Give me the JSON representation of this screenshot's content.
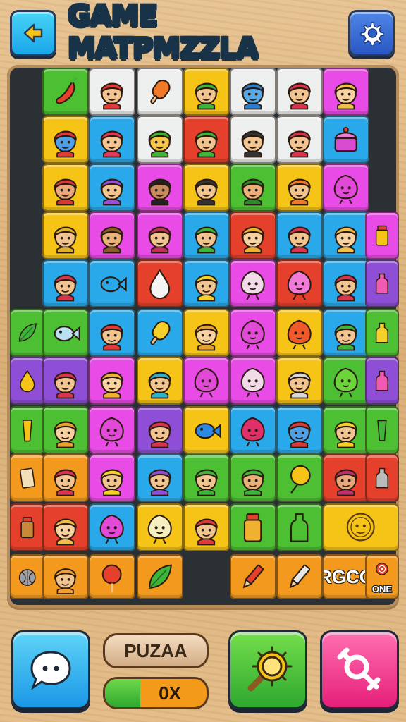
{
  "header": {
    "title": "GAME MATPMZZLA",
    "back_icon": "arrow-left-icon",
    "settings_icon": "gear-icon"
  },
  "colors": {
    "green": "#4cbf32",
    "white": "#eef0f0",
    "yellow": "#f6c417",
    "blue": "#2aa9ea",
    "pink": "#e94be6",
    "red": "#e5402b",
    "orange": "#f39a1e",
    "purple": "#8e4fd6",
    "board": "#2b3035",
    "wood": "#e2bb86"
  },
  "tiles": [
    {
      "row": 0,
      "col": 1,
      "color": "green",
      "icon": "chili-icon"
    },
    {
      "row": 0,
      "col": 2,
      "color": "white",
      "icon": "face-icon",
      "skin": "#f2c48f",
      "hair": "#e03a3a"
    },
    {
      "row": 0,
      "col": 3,
      "color": "white",
      "icon": "popsicle-icon"
    },
    {
      "row": 0,
      "col": 4,
      "color": "yellow",
      "icon": "face-icon",
      "skin": "#f2c48f",
      "hair": "#3fb43a"
    },
    {
      "row": 0,
      "col": 5,
      "color": "white",
      "icon": "face-icon",
      "skin": "#57a8e6",
      "hair": "#2a7fd0"
    },
    {
      "row": 0,
      "col": 6,
      "color": "white",
      "icon": "face-icon",
      "skin": "#f2c48f",
      "hair": "#d8344f"
    },
    {
      "row": 0,
      "col": 7,
      "color": "pink",
      "icon": "face-icon",
      "skin": "#f7d2a0",
      "hair": "#f0c04a"
    },
    {
      "row": 1,
      "col": 1,
      "color": "yellow",
      "icon": "face-icon",
      "skin": "#4ea0e8",
      "hair": "#e23a3a"
    },
    {
      "row": 1,
      "col": 2,
      "color": "blue",
      "icon": "face-icon",
      "skin": "#f2c48f",
      "hair": "#e03a5a"
    },
    {
      "row": 1,
      "col": 3,
      "color": "white",
      "icon": "face-icon",
      "skin": "#f6c84a",
      "hair": "#3fb43a"
    },
    {
      "row": 1,
      "col": 4,
      "color": "red",
      "icon": "face-icon",
      "skin": "#f2c48f",
      "hair": "#3fb43a"
    },
    {
      "row": 1,
      "col": 5,
      "color": "white",
      "icon": "face-icon",
      "skin": "#f2c48f",
      "hair": "#333333"
    },
    {
      "row": 1,
      "col": 6,
      "color": "white",
      "icon": "face-icon",
      "skin": "#f2c48f",
      "hair": "#d8344f"
    },
    {
      "row": 1,
      "col": 7,
      "color": "blue",
      "icon": "cake-icon"
    },
    {
      "row": 2,
      "col": 1,
      "color": "yellow",
      "icon": "face-icon",
      "skin": "#e9a87a",
      "hair": "#d83a3a"
    },
    {
      "row": 2,
      "col": 2,
      "color": "blue",
      "icon": "face-icon",
      "skin": "#f2c48f",
      "hair": "#9a4fd6"
    },
    {
      "row": 2,
      "col": 3,
      "color": "pink",
      "icon": "face-icon",
      "skin": "#c98a5e",
      "hair": "#222222"
    },
    {
      "row": 2,
      "col": 4,
      "color": "yellow",
      "icon": "face-icon",
      "skin": "#f2c48f",
      "hair": "#333333"
    },
    {
      "row": 2,
      "col": 5,
      "color": "green",
      "icon": "face-icon",
      "skin": "#e9b07a",
      "hair": "#2f8a2f"
    },
    {
      "row": 2,
      "col": 6,
      "color": "yellow",
      "icon": "face-icon",
      "skin": "#f2c48f",
      "hair": "#f07a2a"
    },
    {
      "row": 2,
      "col": 7,
      "color": "pink",
      "icon": "blob-icon",
      "fill": "#e04ad6"
    },
    {
      "row": 3,
      "col": 1,
      "color": "yellow",
      "icon": "face-icon",
      "skin": "#f2c48f",
      "hair": "#e0b02a"
    },
    {
      "row": 3,
      "col": 2,
      "color": "pink",
      "icon": "face-icon",
      "skin": "#e9b07a",
      "hair": "#8a5a2a"
    },
    {
      "row": 3,
      "col": 3,
      "color": "pink",
      "icon": "face-icon",
      "skin": "#f2c48f",
      "hair": "#c0305a"
    },
    {
      "row": 3,
      "col": 4,
      "color": "blue",
      "icon": "face-icon",
      "skin": "#f2c48f",
      "hair": "#3fb43a"
    },
    {
      "row": 3,
      "col": 5,
      "color": "red",
      "icon": "face-icon",
      "skin": "#f7d2a0",
      "hair": "#f0b030"
    },
    {
      "row": 3,
      "col": 6,
      "color": "blue",
      "icon": "face-icon",
      "skin": "#f2c48f",
      "hair": "#d8344f"
    },
    {
      "row": 3,
      "col": 7,
      "color": "blue",
      "icon": "face-icon",
      "skin": "#f7d2a0",
      "hair": "#f0c04a"
    },
    {
      "row": 3,
      "col": 8,
      "color": "pink",
      "icon": "jar-icon",
      "fill": "#f6c417",
      "narrow": true
    },
    {
      "row": 4,
      "col": 1,
      "color": "blue",
      "icon": "face-icon",
      "skin": "#f2c48f",
      "hair": "#d8344f"
    },
    {
      "row": 4,
      "col": 2,
      "color": "blue",
      "icon": "fish-icon",
      "fill": "#2aa9ea"
    },
    {
      "row": 4,
      "col": 3,
      "color": "red",
      "icon": "drop-icon",
      "fill": "#f4f4f4"
    },
    {
      "row": 4,
      "col": 4,
      "color": "blue",
      "icon": "face-icon",
      "skin": "#f2c48f",
      "hair": "#f6d02a"
    },
    {
      "row": 4,
      "col": 5,
      "color": "pink",
      "icon": "blob-icon",
      "fill": "#f2dbe8"
    },
    {
      "row": 4,
      "col": 6,
      "color": "red",
      "icon": "blob-icon",
      "fill": "#f07ad8"
    },
    {
      "row": 4,
      "col": 7,
      "color": "blue",
      "icon": "face-icon",
      "skin": "#f2c48f",
      "hair": "#d8344f"
    },
    {
      "row": 4,
      "col": 8,
      "color": "purple",
      "icon": "bottle-icon",
      "fill": "#f05ab0",
      "narrow": true
    },
    {
      "row": 5,
      "col": 0,
      "color": "green",
      "icon": "leaf-icon",
      "fill": "#3fb43a"
    },
    {
      "row": 5,
      "col": 1,
      "color": "green",
      "icon": "fish-icon",
      "fill": "#b8e0f0"
    },
    {
      "row": 5,
      "col": 2,
      "color": "blue",
      "icon": "face-icon",
      "skin": "#f2c48f",
      "hair": "#e03a3a"
    },
    {
      "row": 5,
      "col": 3,
      "color": "blue",
      "icon": "popsicle-icon",
      "fill": "#f6d02a"
    },
    {
      "row": 5,
      "col": 4,
      "color": "yellow",
      "icon": "face-icon",
      "skin": "#f7d2a0",
      "hair": "#e8a030"
    },
    {
      "row": 5,
      "col": 5,
      "color": "pink",
      "icon": "blob-icon",
      "fill": "#e04ad6"
    },
    {
      "row": 5,
      "col": 6,
      "color": "yellow",
      "icon": "blob-icon",
      "fill": "#f05a2a"
    },
    {
      "row": 5,
      "col": 7,
      "color": "blue",
      "icon": "face-icon",
      "skin": "#f2c48f",
      "hair": "#3fb43a"
    },
    {
      "row": 5,
      "col": 8,
      "color": "green",
      "icon": "bottle-icon",
      "fill": "#f6d02a",
      "narrow": true
    },
    {
      "row": 6,
      "col": 0,
      "color": "purple",
      "icon": "drop-icon",
      "fill": "#f6c417"
    },
    {
      "row": 6,
      "col": 1,
      "color": "purple",
      "icon": "face-icon",
      "skin": "#f2c48f",
      "hair": "#d8344f"
    },
    {
      "row": 6,
      "col": 2,
      "color": "pink",
      "icon": "face-icon",
      "skin": "#f7d2a0",
      "hair": "#f0b030"
    },
    {
      "row": 6,
      "col": 3,
      "color": "yellow",
      "icon": "face-icon",
      "skin": "#f2c48f",
      "hair": "#2ab4c8"
    },
    {
      "row": 6,
      "col": 4,
      "color": "pink",
      "icon": "blob-icon",
      "fill": "#e04ad6"
    },
    {
      "row": 6,
      "col": 5,
      "color": "pink",
      "icon": "blob-icon",
      "fill": "#f2dbe8"
    },
    {
      "row": 6,
      "col": 6,
      "color": "yellow",
      "icon": "face-icon",
      "skin": "#f2c48f",
      "hair": "#d8d8d8"
    },
    {
      "row": 6,
      "col": 7,
      "color": "green",
      "icon": "blob-icon",
      "fill": "#6ad43a"
    },
    {
      "row": 6,
      "col": 8,
      "color": "purple",
      "icon": "bottle-icon",
      "fill": "#f05ab0",
      "narrow": true
    },
    {
      "row": 7,
      "col": 0,
      "color": "green",
      "icon": "glass-icon",
      "fill": "#f6c417"
    },
    {
      "row": 7,
      "col": 1,
      "color": "green",
      "icon": "face-icon",
      "skin": "#f7d2a0",
      "hair": "#e8a030"
    },
    {
      "row": 7,
      "col": 2,
      "color": "pink",
      "icon": "blob-icon",
      "fill": "#e04ad6"
    },
    {
      "row": 7,
      "col": 3,
      "color": "purple",
      "icon": "face-icon",
      "skin": "#f2c48f",
      "hair": "#d8344f"
    },
    {
      "row": 7,
      "col": 4,
      "color": "yellow",
      "icon": "fish-icon",
      "fill": "#2a8ae6"
    },
    {
      "row": 7,
      "col": 5,
      "color": "blue",
      "icon": "blob-icon",
      "fill": "#e0306a"
    },
    {
      "row": 7,
      "col": 6,
      "color": "blue",
      "icon": "face-icon",
      "skin": "#4ea0e8",
      "hair": "#d83a3a"
    },
    {
      "row": 7,
      "col": 7,
      "color": "green",
      "icon": "face-icon",
      "skin": "#f2c48f",
      "hair": "#f6d02a"
    },
    {
      "row": 7,
      "col": 8,
      "color": "green",
      "icon": "glass-icon",
      "fill": "#3fb43a",
      "narrow": true
    },
    {
      "row": 8,
      "col": 0,
      "color": "orange",
      "icon": "scroll-icon",
      "fill": "#f2e0b8"
    },
    {
      "row": 8,
      "col": 1,
      "color": "orange",
      "icon": "face-icon",
      "skin": "#f2c48f",
      "hair": "#d8344f"
    },
    {
      "row": 8,
      "col": 2,
      "color": "pink",
      "icon": "face-icon",
      "skin": "#f2c48f",
      "hair": "#f6d02a"
    },
    {
      "row": 8,
      "col": 3,
      "color": "blue",
      "icon": "face-icon",
      "skin": "#f2c48f",
      "hair": "#8e4fd6"
    },
    {
      "row": 8,
      "col": 4,
      "color": "green",
      "icon": "face-icon",
      "skin": "#f2c48f",
      "hair": "#3fb43a"
    },
    {
      "row": 8,
      "col": 5,
      "color": "green",
      "icon": "face-icon",
      "skin": "#e9b07a",
      "hair": "#3fb43a"
    },
    {
      "row": 8,
      "col": 6,
      "color": "green",
      "icon": "balloon-icon",
      "fill": "#f6c417"
    },
    {
      "row": 8,
      "col": 7,
      "color": "red",
      "icon": "face-icon",
      "skin": "#e9a87a",
      "hair": "#c0306a"
    },
    {
      "row": 8,
      "col": 8,
      "color": "red",
      "icon": "bottle-icon",
      "fill": "#bbbbbb",
      "narrow": true
    },
    {
      "row": 9,
      "col": 0,
      "color": "red",
      "icon": "jar-icon",
      "fill": "#c88a3a"
    },
    {
      "row": 9,
      "col": 1,
      "color": "red",
      "icon": "face-icon",
      "skin": "#f7d2a0",
      "hair": "#f0c04a"
    },
    {
      "row": 9,
      "col": 2,
      "color": "blue",
      "icon": "blob-icon",
      "fill": "#e04ad6"
    },
    {
      "row": 9,
      "col": 3,
      "color": "yellow",
      "icon": "blob-icon",
      "fill": "#f6f0c0"
    },
    {
      "row": 9,
      "col": 4,
      "color": "yellow",
      "icon": "face-icon",
      "skin": "#f2c48f",
      "hair": "#e03a3a"
    },
    {
      "row": 9,
      "col": 5,
      "color": "green",
      "icon": "jar-icon",
      "fill": "#f0b030"
    },
    {
      "row": 9,
      "col": 6,
      "color": "green",
      "icon": "bottle-icon",
      "fill": "#4cbf32"
    },
    {
      "row": 9,
      "col": 7,
      "color": "yellow",
      "icon": "sun-face-icon",
      "wide": true
    },
    {
      "row": 10,
      "col": 0,
      "color": "orange",
      "icon": "ball-icon",
      "fill": "#9aa0a8"
    },
    {
      "row": 10,
      "col": 1,
      "color": "orange",
      "icon": "face-icon",
      "skin": "#f2c48f",
      "hair": "#f0a030"
    },
    {
      "row": 10,
      "col": 2,
      "color": "orange",
      "icon": "lollipop-icon",
      "fill": "#e5402b"
    },
    {
      "row": 10,
      "col": 3,
      "color": "orange",
      "icon": "leaf-icon",
      "fill": "#3fb43a"
    },
    {
      "row": 10,
      "col": 5,
      "color": "orange",
      "icon": "pencil-icon",
      "fill": "#e5402b"
    },
    {
      "row": 10,
      "col": 6,
      "color": "orange",
      "icon": "pencil-icon",
      "fill": "#e8e8e8"
    },
    {
      "row": 10,
      "col": 7,
      "color": "orange",
      "icon": "text",
      "label": "RGCO"
    },
    {
      "row": 10,
      "col": 8,
      "color": "orange",
      "icon": "target-icon",
      "label": "ONE",
      "narrow": true
    }
  ],
  "bottom": {
    "puzzle_label": "PUZAA",
    "progress_label": "0X",
    "progress": 0.35,
    "chat_icon": "chat-bubble-icon",
    "search_icon": "magnifier-icon",
    "gender_icon": "gender-icon"
  }
}
